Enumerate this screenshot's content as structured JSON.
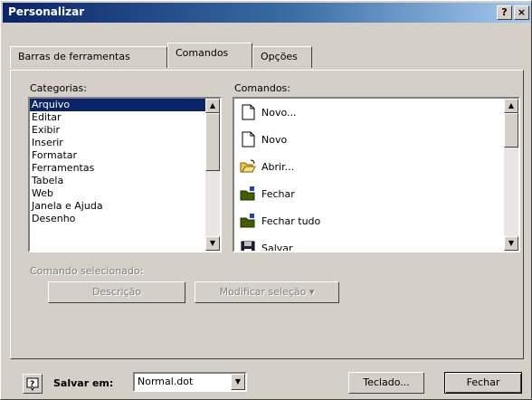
{
  "window": {
    "title": "Personalizar",
    "help_glyph": "?",
    "close_glyph": "×"
  },
  "tabs": [
    {
      "label": "Barras de ferramentas",
      "active": false
    },
    {
      "label": "Comandos",
      "active": true
    },
    {
      "label": "Opções",
      "active": false
    }
  ],
  "categories": {
    "label": "Categorias:",
    "selected": "Arquivo",
    "items": [
      "Arquivo",
      "Editar",
      "Exibir",
      "Inserir",
      "Formatar",
      "Ferramentas",
      "Tabela",
      "Web",
      "Janela e Ajuda",
      "Desenho"
    ]
  },
  "commands": {
    "label": "Comandos:",
    "items": [
      {
        "label": "Novo...",
        "icon": "new-document-icon"
      },
      {
        "label": "Novo",
        "icon": "new-document-icon"
      },
      {
        "label": "Abrir...",
        "icon": "open-folder-icon"
      },
      {
        "label": "Fechar",
        "icon": "close-folder-icon"
      },
      {
        "label": "Fechar tudo",
        "icon": "close-folder-icon"
      },
      {
        "label": "Salvar",
        "icon": "floppy-disk-icon"
      }
    ]
  },
  "selected_command": {
    "label": "Comando selecionado:",
    "description_button": "Descrição",
    "modify_button": "Modificar seleção ▾"
  },
  "footer": {
    "help_icon": "help-icon",
    "save_in_label": "Salvar em:",
    "save_in_value": "Normal.dot",
    "keyboard_button": "Teclado...",
    "close_button": "Fechar"
  },
  "colors": {
    "titlebar_start": "#0a246a",
    "titlebar_end": "#a6caf0",
    "face": "#d4d0c8",
    "selection": "#0a246a"
  }
}
